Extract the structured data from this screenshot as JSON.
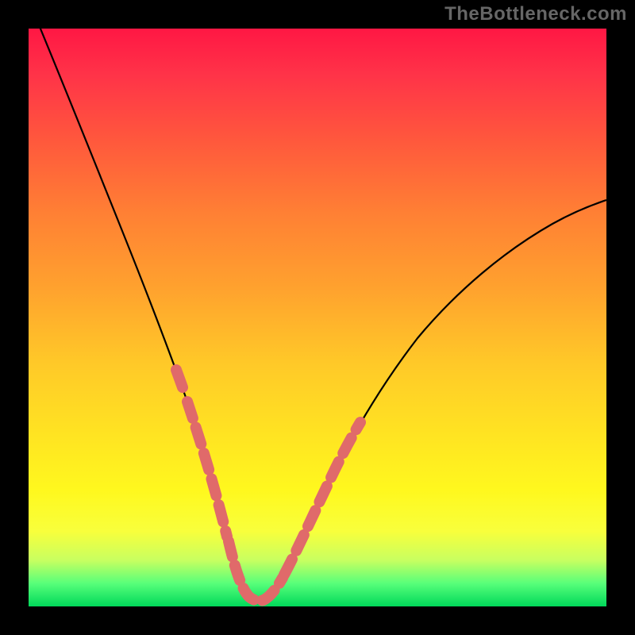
{
  "watermark": "TheBottleneck.com",
  "chart_data": {
    "type": "line",
    "title": "",
    "xlabel": "",
    "ylabel": "",
    "xlim": [
      0,
      100
    ],
    "ylim": [
      0,
      100
    ],
    "grid": false,
    "series": [
      {
        "name": "bottleneck-curve",
        "x": [
          0,
          5,
          10,
          15,
          20,
          24,
          28,
          31,
          33.5,
          36,
          38,
          40,
          44,
          50,
          56,
          62,
          70,
          80,
          90,
          100
        ],
        "y": [
          105,
          86,
          68,
          51,
          36,
          24,
          14,
          7,
          3,
          1,
          1,
          2,
          6,
          14,
          23,
          32,
          42,
          53,
          62,
          69
        ]
      }
    ],
    "highlight_segments": [
      {
        "name": "left-dashes",
        "x_range": [
          24,
          31
        ],
        "y_range": [
          24,
          7
        ]
      },
      {
        "name": "bottom-dashes",
        "x_range": [
          33,
          40
        ],
        "y_range": [
          3,
          3
        ]
      },
      {
        "name": "right-dashes",
        "x_range": [
          42,
          50
        ],
        "y_range": [
          5,
          14
        ]
      }
    ],
    "colors": {
      "curve": "#000000",
      "highlight": "#e06a6a",
      "background_top": "#ff1744",
      "background_bottom": "#00d85a",
      "frame": "#000000"
    }
  }
}
